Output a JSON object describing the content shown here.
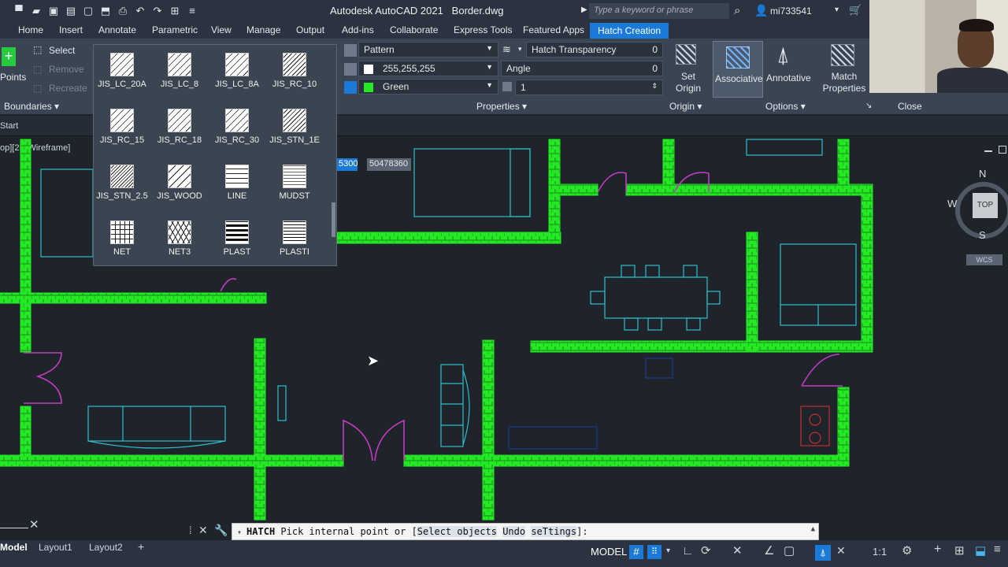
{
  "titlebar": {
    "app_title": "Autodesk AutoCAD 2021",
    "file_name": "Border.dwg",
    "search_placeholder": "Type a keyword or phrase",
    "user": "mi733541"
  },
  "ribbon_tabs": [
    "Home",
    "Insert",
    "Annotate",
    "Parametric",
    "View",
    "Manage",
    "Output",
    "Add-ins",
    "Collaborate",
    "Express Tools",
    "Featured Apps",
    "Hatch Creation"
  ],
  "ribbon": {
    "boundaries": {
      "pick_points": "Points",
      "select": "Select",
      "remove": "Remove",
      "recreate": "Recreate",
      "title": "Boundaries"
    },
    "properties": {
      "pattern_type": "Pattern",
      "hatch_color": "255,255,255",
      "bg_color": "Green",
      "transparency_label": "Hatch Transparency",
      "transparency_value": "0",
      "angle_label": "Angle",
      "angle_value": "0",
      "scale_value": "1",
      "title": "Properties"
    },
    "origin": {
      "set_origin": "Set Origin",
      "title": "Origin"
    },
    "options": {
      "associative": "Associative",
      "annotative": "Annotative",
      "match_properties": "Match Properties",
      "title": "Options"
    },
    "close": {
      "title": "Close"
    }
  },
  "doc_tabs": {
    "start": "Start"
  },
  "viewport": {
    "view_label": "op][2D Wireframe]",
    "coord_1": "5300",
    "coord_2": "50478360",
    "compass": {
      "n": "N",
      "s": "S",
      "w": "W",
      "top": "TOP",
      "wcs": "WCS"
    }
  },
  "pattern_popup": {
    "patterns": [
      {
        "name": "JIS_LC_20A",
        "icon": "diagonal-hatch"
      },
      {
        "name": "JIS_LC_8",
        "icon": "diagonal-hatch"
      },
      {
        "name": "JIS_LC_8A",
        "icon": "diagonal-hatch"
      },
      {
        "name": "JIS_RC_10",
        "icon": "diagonal-hatch"
      },
      {
        "name": "JIS_RC_15",
        "icon": "diagonal-hatch"
      },
      {
        "name": "JIS_RC_18",
        "icon": "diagonal-hatch"
      },
      {
        "name": "JIS_RC_30",
        "icon": "diagonal-hatch"
      },
      {
        "name": "JIS_STN_1E",
        "icon": "diagonal-hatch"
      },
      {
        "name": "JIS_STN_2.5",
        "icon": "dense-diagonal-hatch"
      },
      {
        "name": "JIS_WOOD",
        "icon": "diagonal-hatch"
      },
      {
        "name": "LINE",
        "icon": "horizontal-lines"
      },
      {
        "name": "MUDST",
        "icon": "dashed-lines"
      },
      {
        "name": "NET",
        "icon": "grid"
      },
      {
        "name": "NET3",
        "icon": "triangle-grid"
      },
      {
        "name": "PLAST",
        "icon": "thick-lines"
      },
      {
        "name": "PLASTI",
        "icon": "thin-lines"
      }
    ]
  },
  "command_line": {
    "command": "HATCH",
    "prompt": "Pick internal point or [",
    "opt1": "Select objects",
    "opt2": "Undo",
    "opt3": "seTtings",
    "suffix": "]:"
  },
  "statusbar": {
    "tabs": [
      "Model",
      "Layout1",
      "Layout2"
    ],
    "model_btn": "MODEL",
    "scale": "1:1"
  },
  "colors": {
    "wall": "#23e823",
    "cyan": "#2dbfc9",
    "magenta": "#c23bc2",
    "accent": "#1b7ad8"
  }
}
